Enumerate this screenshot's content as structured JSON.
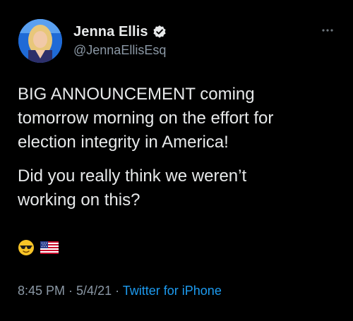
{
  "author": {
    "display_name": "Jenna Ellis",
    "handle": "@JennaEllisEsq",
    "verified": true
  },
  "icons": {
    "verified": "verified-badge-icon",
    "more": "more-horizontal-icon",
    "emoji_1": "sunglasses-face-icon",
    "emoji_2": "us-flag-icon"
  },
  "tweet": {
    "paragraph_1": "BIG ANNOUNCEMENT coming\ntomorrow morning on the effort for\nelection integrity in America!",
    "paragraph_2": "Did you really think we weren’t\nworking on this?"
  },
  "meta": {
    "time": "8:45 PM",
    "separator_1": " · ",
    "date": "5/4/21",
    "separator_2": " · ",
    "source": "Twitter for iPhone"
  },
  "colors": {
    "background": "#000000",
    "text": "#e7e9ea",
    "secondary": "#8b98a5",
    "accent": "#1d9bf0"
  }
}
